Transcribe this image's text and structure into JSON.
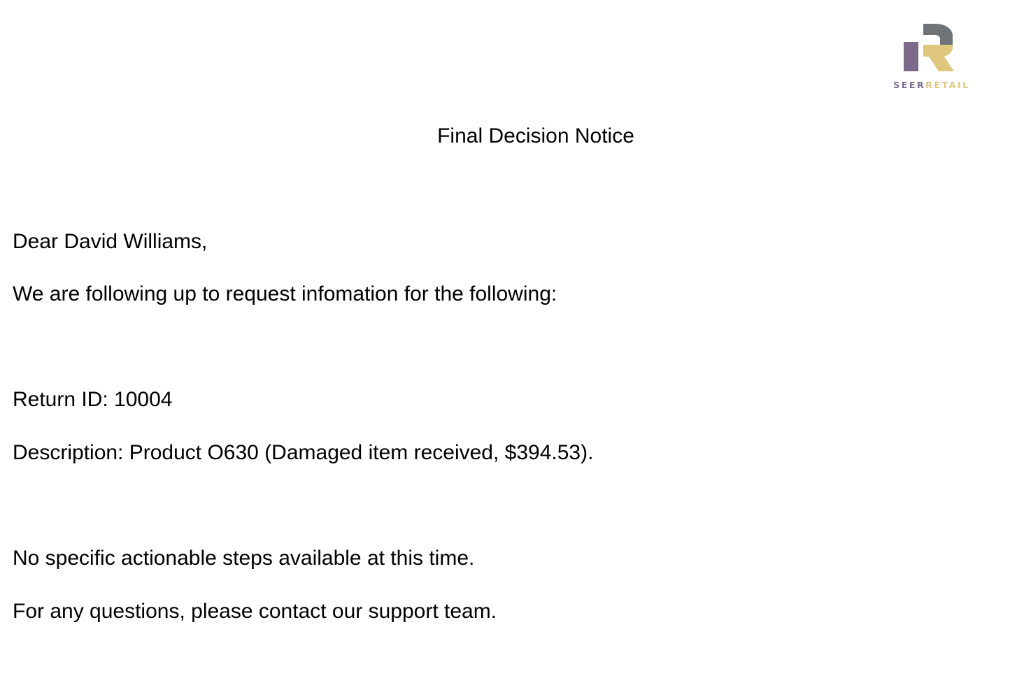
{
  "brand": {
    "wordmark_part1": "SEER",
    "wordmark_part2": "RETAIL",
    "colors": {
      "purple": "#7b6a8c",
      "gold": "#e0c77e",
      "gray": "#6e7378"
    }
  },
  "document": {
    "title": "Final Decision Notice",
    "greeting": "Dear David Williams,",
    "intro": "We are following up to request infomation for the following:",
    "return_id_line": "Return ID: 10004",
    "description_line": "Description: Product O630 (Damaged item received, $394.53).",
    "actionable_steps": "No specific actionable steps available at this time.",
    "contact": "For any questions, please contact our support team."
  }
}
